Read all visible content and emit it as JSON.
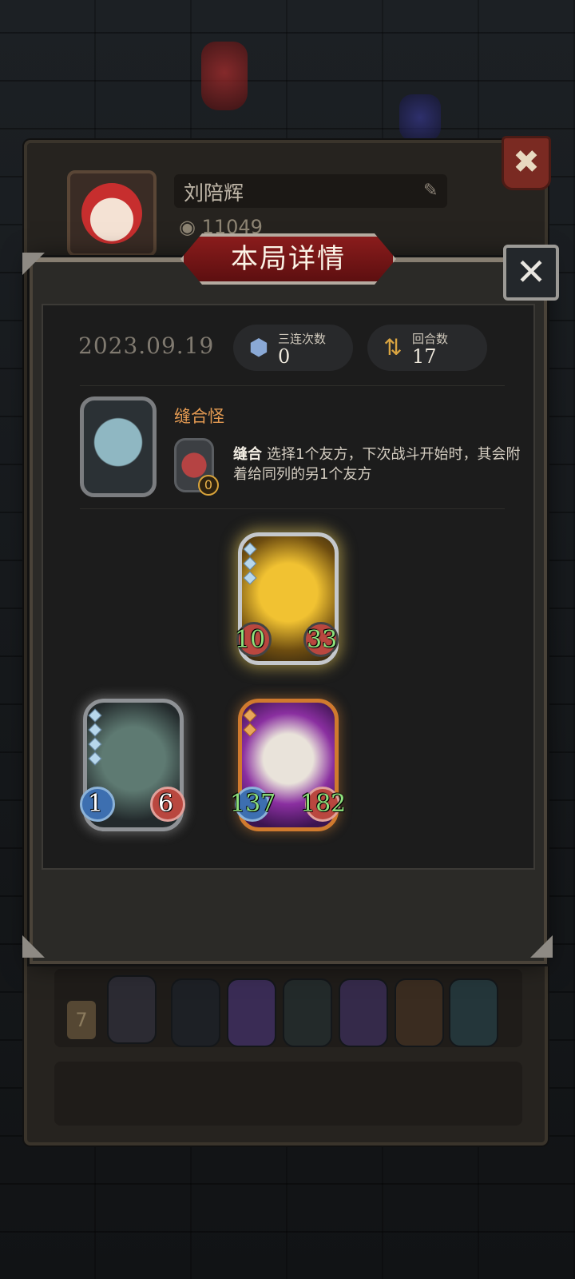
{
  "profile": {
    "player_name": "刘陪辉",
    "coins": "11049",
    "history_rank": "7"
  },
  "dialog": {
    "title": "本局详情",
    "date": "2023.09.19",
    "triples_label": "三连次数",
    "triples_value": "0",
    "rounds_label": "回合数",
    "rounds_value": "17"
  },
  "hero": {
    "name": "缝合怪",
    "ability_name": "缝合",
    "ability_desc": "选择1个友方，下次战斗开始时，其会附着给同列的另1个友方",
    "ability_badge": "0"
  },
  "cards": [
    {
      "name": "golden-dragon",
      "attack": "10",
      "health": "33",
      "rarity_color": "#e7b93a"
    },
    {
      "name": "shark-warrior",
      "attack": "1",
      "health": "6",
      "rarity_color": "#9aa0a6"
    },
    {
      "name": "eagle-warrior",
      "attack": "137",
      "health": "182",
      "rarity_color": "#d87b2c"
    }
  ],
  "icons": {
    "close": "close-icon",
    "triples": "triple-merge-icon",
    "rounds": "cycle-arrows-icon",
    "pencil": "pencil-icon",
    "coin": "coin-icon"
  }
}
